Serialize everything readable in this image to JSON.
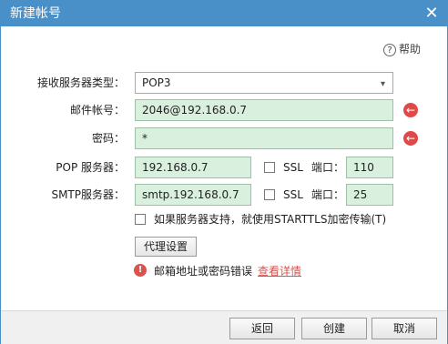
{
  "window": {
    "title": "新建帐号",
    "close_label": "✕"
  },
  "help": {
    "label": "帮助",
    "icon": "?"
  },
  "server_type": {
    "label": "接收服务器类型：",
    "value": "POP3",
    "chevron": "▾"
  },
  "email": {
    "label": "邮件帐号：",
    "value": "2046@192.168.0.7",
    "clear_icon": "←"
  },
  "password": {
    "label": "密码：",
    "value": "*",
    "clear_icon": "←"
  },
  "pop": {
    "label": "POP 服务器：",
    "value": "192.168.0.7",
    "ssl_label": "SSL",
    "port_label": "端口：",
    "port": "110"
  },
  "smtp": {
    "label": "SMTP服务器：",
    "value": "smtp.192.168.0.7",
    "ssl_label": "SSL",
    "port_label": "端口：",
    "port": "25"
  },
  "starttls": {
    "label": "如果服务器支持，就使用STARTTLS加密传输(T)"
  },
  "proxy_button": "代理设置",
  "error": {
    "icon": "!",
    "message": "邮箱地址或密码错误",
    "link": "查看详情"
  },
  "footer": {
    "back": "返回",
    "create": "创建",
    "cancel": "取消"
  }
}
